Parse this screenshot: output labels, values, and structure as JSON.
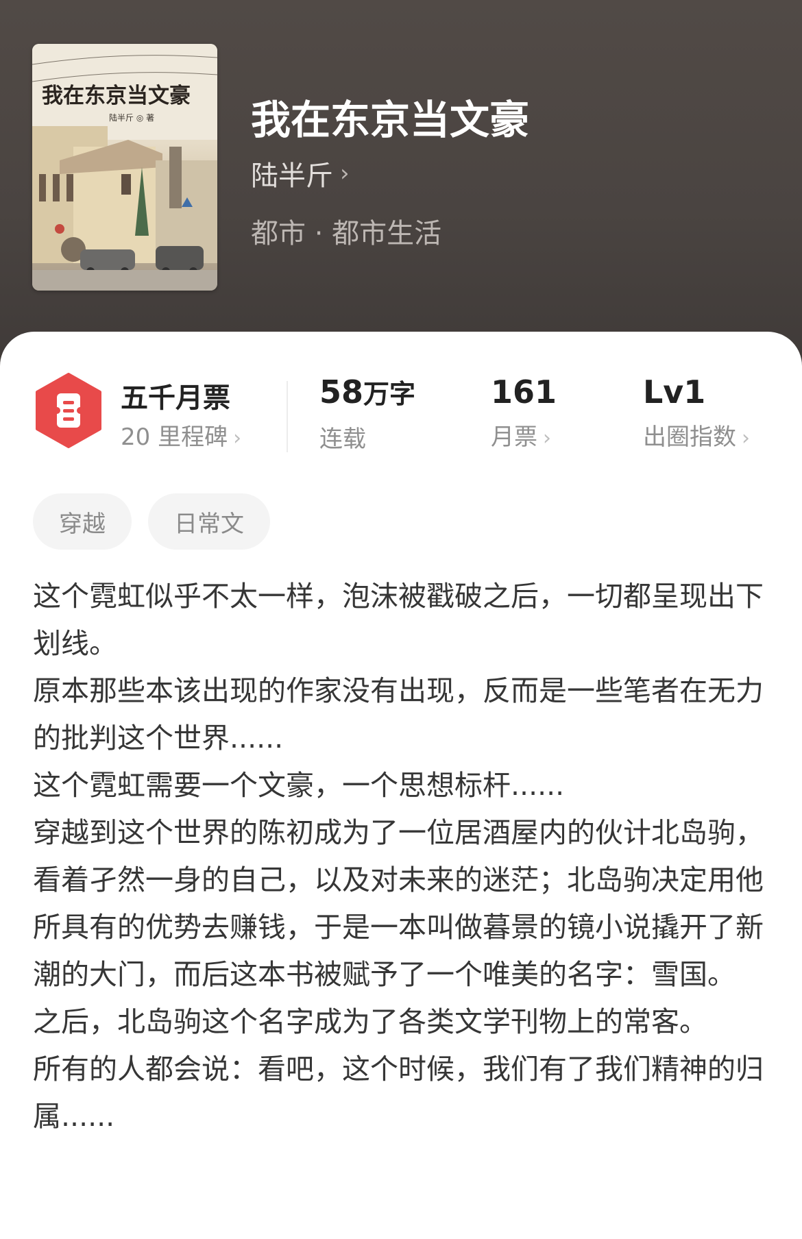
{
  "book": {
    "cover_title": "我在东京当文豪",
    "cover_author": "陆半斤 ◎ 著",
    "title": "我在东京当文豪",
    "author": "陆半斤",
    "genre": "都市 · 都市生活"
  },
  "stats": {
    "milestone_title": "五千月票",
    "milestone_sub": "20 里程碑",
    "word_count_num": "58",
    "word_count_unit": "万字",
    "status": "连载",
    "monthly_votes": "161",
    "monthly_votes_label": "月票",
    "level": "Lv1",
    "level_label": "出圈指数"
  },
  "tags": [
    "穿越",
    "日常文"
  ],
  "description": [
    "这个霓虹似乎不太一样，泡沫被戳破之后，一切都呈现出下划线。",
    "原本那些本该出现的作家没有出现，反而是一些笔者在无力的批判这个世界......",
    "这个霓虹需要一个文豪，一个思想标杆......",
    "穿越到这个世界的陈初成为了一位居酒屋内的伙计北岛驹，看着孑然一身的自己，以及对未来的迷茫；北岛驹决定用他所具有的优势去赚钱，于是一本叫做暮景的镜小说撬开了新潮的大门，而后这本书被赋予了一个唯美的名字：雪国。",
    "之后，北岛驹这个名字成为了各类文学刊物上的常客。",
    "所有的人都会说：看吧，这个时候，我们有了我们精神的归属......"
  ],
  "colors": {
    "header_bg": "#4a4441",
    "badge_red": "#e84a4a",
    "text_dark": "#222222",
    "text_gray": "#8f8f8f"
  },
  "icons": {
    "author_link": "chevron-right-icon",
    "badge": "ticket-badge-icon"
  }
}
